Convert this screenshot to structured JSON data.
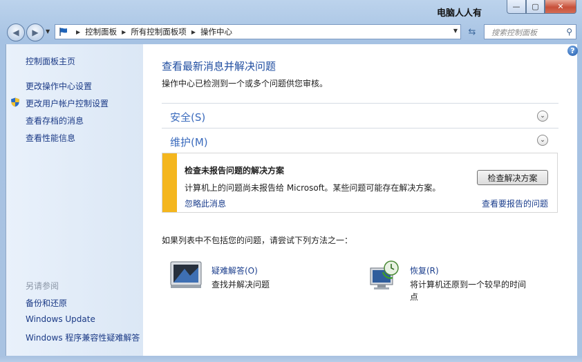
{
  "window": {
    "title": "电脑人人有",
    "min_label": "—",
    "max_label": "▢",
    "close_label": "✕"
  },
  "nav": {
    "back_glyph": "◀",
    "forward_glyph": "▶",
    "drop_glyph": "▼",
    "refresh_glyph": "⇆",
    "breadcrumbs": [
      "控制面板",
      "所有控制面板项",
      "操作中心"
    ],
    "sep_glyph": "▶",
    "search_placeholder": "搜索控制面板",
    "search_glyph": "⚲"
  },
  "sidebar": {
    "home": "控制面板主页",
    "items": [
      "更改操作中心设置",
      "更改用户帐户控制设置",
      "查看存档的消息",
      "查看性能信息"
    ],
    "see_also_header": "另请参阅",
    "see_also": [
      "备份和还原",
      "Windows Update",
      "Windows 程序兼容性疑难解答"
    ]
  },
  "main": {
    "help_glyph": "?",
    "heading": "查看最新消息并解决问题",
    "subheading": "操作中心已检测到一个或多个问题供您审核。",
    "sections": [
      {
        "label": "安全(S)",
        "chevron": "⌄"
      },
      {
        "label": "维护(M)",
        "chevron": "⌄"
      }
    ],
    "alert": {
      "title": "检查未报告问题的解决方案",
      "message": "计算机上的问题尚未报告给 Microsoft。某些问题可能存在解决方案。",
      "button": "检查解决方案",
      "ignore_link": "忽略此消息",
      "view_link": "查看要报告的问题",
      "accent_color": "#f4b61e"
    },
    "try_text": "如果列表中不包括您的问题，请尝试下列方法之一：",
    "tools": [
      {
        "title": "疑难解答(O)",
        "desc": "查找并解决问题",
        "icon": "troubleshoot-icon"
      },
      {
        "title": "恢复(R)",
        "desc": "将计算机还原到一个较早的时间点",
        "icon": "recovery-icon"
      }
    ]
  }
}
